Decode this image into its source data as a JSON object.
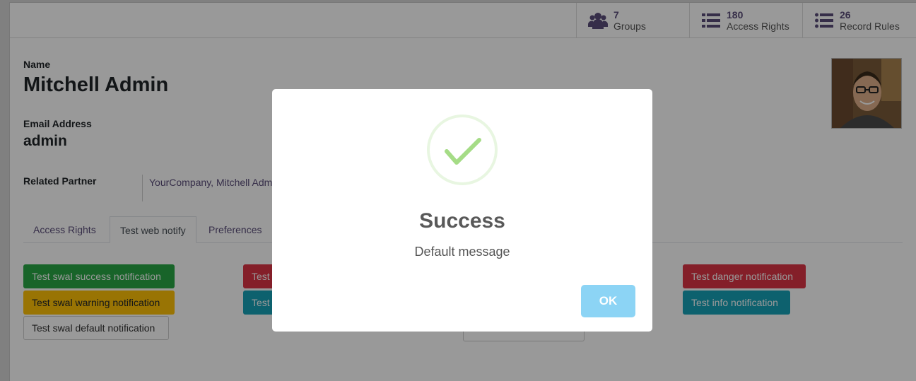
{
  "stats": [
    {
      "icon": "users-icon",
      "count": "7",
      "label": "Groups"
    },
    {
      "icon": "list-icon",
      "count": "180",
      "label": "Access Rights"
    },
    {
      "icon": "list-icon",
      "count": "26",
      "label": "Record Rules"
    }
  ],
  "form": {
    "name_label": "Name",
    "name_value": "Mitchell Admin",
    "email_label": "Email Address",
    "email_value": "admin",
    "partner_label": "Related Partner",
    "partner_value": "YourCompany, Mitchell Admin"
  },
  "tabs": [
    "Access Rights",
    "Test web notify",
    "Preferences"
  ],
  "active_tab": "Test web notify",
  "buttons": {
    "swal_success": "Test swal success notification",
    "swal_warning": "Test swal warning notification",
    "swal_default": "Test swal default notification",
    "mid_danger": "Test",
    "mid_info": "Test",
    "danger": "Test danger notification",
    "info": "Test info notification"
  },
  "dialog": {
    "title": "Success",
    "message": "Default message",
    "ok_label": "OK",
    "icon": "success-check-icon",
    "confirm_color": "#8cd4f5",
    "check_color": "#a5dc86"
  }
}
